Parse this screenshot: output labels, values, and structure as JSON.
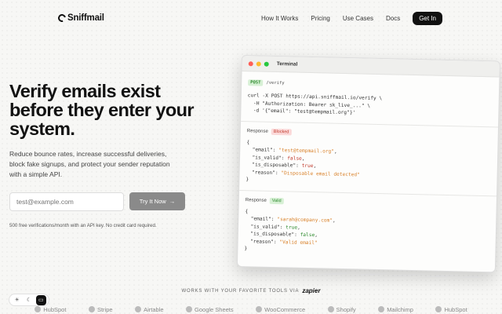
{
  "nav": {
    "logo": "Sniffmail",
    "links": [
      "How It Works",
      "Pricing",
      "Use Cases",
      "Docs"
    ],
    "cta": "Get In"
  },
  "hero": {
    "title": "Verify emails exist before they enter your system.",
    "subtitle": "Reduce bounce rates, increase successful deliveries, block fake signups, and protect your sender reputation with a simple API.",
    "input_placeholder": "test@example.com",
    "button": "Try It Now",
    "note": "500 free verifications/month with an API key. No credit card required."
  },
  "terminal": {
    "title": "Terminal",
    "method": "POST",
    "path": "/verify",
    "curl_lines": [
      "curl -X POST https://api.sniffmail.io/verify \\",
      "  -H \"Authorization: Bearer sk_live_...\" \\",
      "  -d '{\"email\": \"test@tempmail.org\"}'"
    ],
    "response_label": "Response",
    "blocked": {
      "badge": "Blocked",
      "email": "test@tempmail.org",
      "is_valid": "false",
      "is_disposable": "true",
      "reason": "Disposable email detected"
    },
    "valid": {
      "badge": "Valid",
      "email": "sarah@company.com",
      "is_valid": "true",
      "is_disposable": "false",
      "reason": "Valid email"
    }
  },
  "integrations": {
    "heading": "WORKS WITH YOUR FAVORITE TOOLS VIA",
    "zapier": "zapier",
    "tools": [
      "HubSpot",
      "Stripe",
      "Airtable",
      "Google Sheets",
      "WooCommerce",
      "Shopify",
      "Mailchimp",
      "HubSpot"
    ]
  },
  "theme": {
    "icons": [
      "sun-icon",
      "moon-icon",
      "monitor-icon"
    ],
    "active": "monitor-icon"
  },
  "colors": {
    "accent": "#111111",
    "green": "#2d8a2d",
    "red": "#c0392b",
    "orange": "#d9822b"
  }
}
